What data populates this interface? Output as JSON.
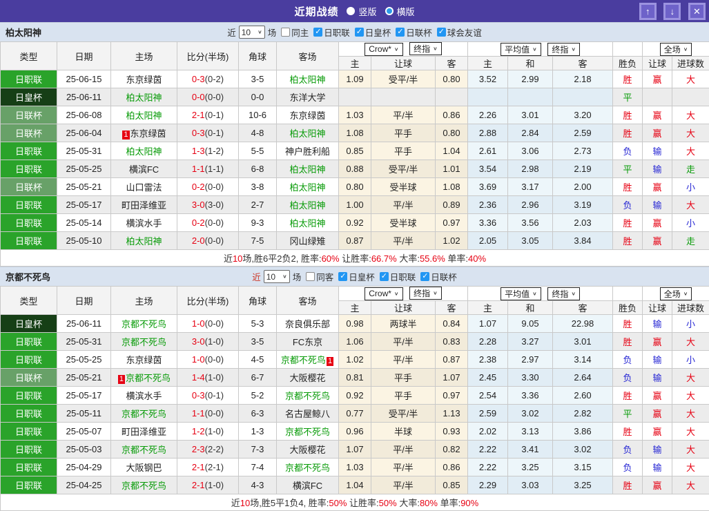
{
  "titlebar": {
    "title": "近期战绩",
    "radio_vertical": "竖版",
    "radio_horizontal": "横版",
    "up_button": "↑",
    "down_button": "↓",
    "close_button": "✕"
  },
  "colors": {
    "header_purple": "#4a3d9f",
    "section_bg": "#d9e3f0",
    "league_green": "#2aa32a",
    "emperor_cup_green": "#163f16",
    "levain_cup_green": "#68a168",
    "win_red": "#e60012",
    "lose_blue": "#2727d4",
    "draw_green": "#089b08",
    "checkbox_blue": "#2196f3"
  },
  "columns": [
    "类型",
    "日期",
    "主场",
    "比分(半场)",
    "角球",
    "客场"
  ],
  "odds_columns": [
    "主",
    "让球",
    "客",
    "主",
    "和",
    "客",
    "胜负",
    "让球",
    "进球数"
  ],
  "odds_header": {
    "bookmaker": "Crow*",
    "final": "终指",
    "average": "平均值",
    "fulltime": "全场"
  },
  "sections": [
    {
      "team": "柏太阳神",
      "filter": {
        "near": "近",
        "count": "10",
        "games": "场",
        "checkboxes": [
          {
            "label": "同主",
            "checked": false
          },
          {
            "label": "日职联",
            "checked": true
          },
          {
            "label": "日皇杯",
            "checked": true
          },
          {
            "label": "日联杯",
            "checked": true
          },
          {
            "label": "球会友谊",
            "checked": true
          }
        ]
      },
      "rows": [
        {
          "type": "日职联",
          "date": "25-06-15",
          "home": "东京绿茵",
          "score": "0-3",
          "half": "(0-2)",
          "corner": "3-5",
          "away": "柏太阳神",
          "away_focal": true,
          "odds": [
            "1.09",
            "受平/半",
            "0.80",
            "3.52",
            "2.99",
            "2.18"
          ],
          "results": [
            "胜",
            "赢",
            "大"
          ]
        },
        {
          "type": "日皇杯",
          "date": "25-06-11",
          "home": "柏太阳神",
          "home_focal": true,
          "score": "0-0",
          "half": "(0-0)",
          "corner": "0-0",
          "away": "东洋大学",
          "odds": [
            "",
            "",
            "",
            "",
            "",
            ""
          ],
          "results": [
            "平",
            "",
            ""
          ]
        },
        {
          "type": "日联杯",
          "date": "25-06-08",
          "home": "柏太阳神",
          "home_focal": true,
          "score": "2-1",
          "half": "(0-1)",
          "corner": "10-6",
          "away": "东京绿茵",
          "odds": [
            "1.03",
            "平/半",
            "0.86",
            "2.26",
            "3.01",
            "3.20"
          ],
          "results": [
            "胜",
            "赢",
            "大"
          ]
        },
        {
          "type": "日联杯",
          "date": "25-06-04",
          "home": "东京绿茵",
          "home_card": "1",
          "score": "0-3",
          "half": "(0-1)",
          "corner": "4-8",
          "away": "柏太阳神",
          "away_focal": true,
          "odds": [
            "1.08",
            "平手",
            "0.80",
            "2.88",
            "2.84",
            "2.59"
          ],
          "results": [
            "胜",
            "赢",
            "大"
          ]
        },
        {
          "type": "日职联",
          "date": "25-05-31",
          "home": "柏太阳神",
          "home_focal": true,
          "score": "1-3",
          "half": "(1-2)",
          "corner": "5-5",
          "away": "神户胜利船",
          "odds": [
            "0.85",
            "平手",
            "1.04",
            "2.61",
            "3.06",
            "2.73"
          ],
          "results": [
            "负",
            "输",
            "大"
          ]
        },
        {
          "type": "日职联",
          "date": "25-05-25",
          "home": "横滨FC",
          "score": "1-1",
          "half": "(1-1)",
          "corner": "6-8",
          "away": "柏太阳神",
          "away_focal": true,
          "odds": [
            "0.88",
            "受平/半",
            "1.01",
            "3.54",
            "2.98",
            "2.19"
          ],
          "results": [
            "平",
            "输",
            "走"
          ]
        },
        {
          "type": "日联杯",
          "date": "25-05-21",
          "home": "山口雷法",
          "score": "0-2",
          "half": "(0-0)",
          "corner": "3-8",
          "away": "柏太阳神",
          "away_focal": true,
          "odds": [
            "0.80",
            "受半球",
            "1.08",
            "3.69",
            "3.17",
            "2.00"
          ],
          "results": [
            "胜",
            "赢",
            "小"
          ]
        },
        {
          "type": "日职联",
          "date": "25-05-17",
          "home": "町田泽维亚",
          "score": "3-0",
          "half": "(3-0)",
          "corner": "2-7",
          "away": "柏太阳神",
          "away_focal": true,
          "odds": [
            "1.00",
            "平/半",
            "0.89",
            "2.36",
            "2.96",
            "3.19"
          ],
          "results": [
            "负",
            "输",
            "大"
          ]
        },
        {
          "type": "日职联",
          "date": "25-05-14",
          "home": "横滨水手",
          "score": "0-2",
          "half": "(0-0)",
          "corner": "9-3",
          "away": "柏太阳神",
          "away_focal": true,
          "odds": [
            "0.92",
            "受半球",
            "0.97",
            "3.36",
            "3.56",
            "2.03"
          ],
          "results": [
            "胜",
            "赢",
            "小"
          ]
        },
        {
          "type": "日职联",
          "date": "25-05-10",
          "home": "柏太阳神",
          "home_focal": true,
          "score": "2-0",
          "half": "(0-0)",
          "corner": "7-5",
          "away": "冈山绿雉",
          "odds": [
            "0.87",
            "平/半",
            "1.02",
            "2.05",
            "3.05",
            "3.84"
          ],
          "results": [
            "胜",
            "赢",
            "走"
          ]
        }
      ],
      "summary": [
        {
          "t": "近",
          "red": false
        },
        {
          "t": "10",
          "red": true
        },
        {
          "t": "场,胜6平2负2, 胜率:",
          "red": false
        },
        {
          "t": "60%",
          "red": true
        },
        {
          "t": " 让胜率:",
          "red": false
        },
        {
          "t": "66.7%",
          "red": true
        },
        {
          "t": " 大率:",
          "red": false
        },
        {
          "t": "55.6%",
          "red": true
        },
        {
          "t": " 单率:",
          "red": false
        },
        {
          "t": "40%",
          "red": true
        }
      ]
    },
    {
      "team": "京都不死鸟",
      "filter": {
        "near": "近",
        "count": "10",
        "games": "场",
        "checkboxes": [
          {
            "label": "同客",
            "checked": false
          },
          {
            "label": "日皇杯",
            "checked": true
          },
          {
            "label": "日职联",
            "checked": true
          },
          {
            "label": "日联杯",
            "checked": true
          }
        ]
      },
      "rows": [
        {
          "type": "日皇杯",
          "date": "25-06-11",
          "home": "京都不死鸟",
          "home_focal": true,
          "score": "1-0",
          "half": "(0-0)",
          "corner": "5-3",
          "away": "奈良俱乐部",
          "odds": [
            "0.98",
            "两球半",
            "0.84",
            "1.07",
            "9.05",
            "22.98"
          ],
          "results": [
            "胜",
            "输",
            "小"
          ]
        },
        {
          "type": "日职联",
          "date": "25-05-31",
          "home": "京都不死鸟",
          "home_focal": true,
          "score": "3-0",
          "half": "(1-0)",
          "corner": "3-5",
          "away": "FC东京",
          "odds": [
            "1.06",
            "平/半",
            "0.83",
            "2.28",
            "3.27",
            "3.01"
          ],
          "results": [
            "胜",
            "赢",
            "大"
          ]
        },
        {
          "type": "日职联",
          "date": "25-05-25",
          "home": "东京绿茵",
          "score": "1-0",
          "half": "(0-0)",
          "corner": "4-5",
          "away": "京都不死鸟",
          "away_focal": true,
          "away_card": "1",
          "odds": [
            "1.02",
            "平/半",
            "0.87",
            "2.38",
            "2.97",
            "3.14"
          ],
          "results": [
            "负",
            "输",
            "小"
          ]
        },
        {
          "type": "日联杯",
          "date": "25-05-21",
          "home": "京都不死鸟",
          "home_focal": true,
          "home_card": "1",
          "score": "1-4",
          "half": "(1-0)",
          "corner": "6-7",
          "away": "大阪樱花",
          "odds": [
            "0.81",
            "平手",
            "1.07",
            "2.45",
            "3.30",
            "2.64"
          ],
          "results": [
            "负",
            "输",
            "大"
          ]
        },
        {
          "type": "日职联",
          "date": "25-05-17",
          "home": "横滨水手",
          "score": "0-3",
          "half": "(0-1)",
          "corner": "5-2",
          "away": "京都不死鸟",
          "away_focal": true,
          "odds": [
            "0.92",
            "平手",
            "0.97",
            "2.54",
            "3.36",
            "2.60"
          ],
          "results": [
            "胜",
            "赢",
            "大"
          ]
        },
        {
          "type": "日职联",
          "date": "25-05-11",
          "home": "京都不死鸟",
          "home_focal": true,
          "score": "1-1",
          "half": "(0-0)",
          "corner": "6-3",
          "away": "名古屋鲸八",
          "odds": [
            "0.77",
            "受平/半",
            "1.13",
            "2.59",
            "3.02",
            "2.82"
          ],
          "results": [
            "平",
            "赢",
            "大"
          ]
        },
        {
          "type": "日职联",
          "date": "25-05-07",
          "home": "町田泽维亚",
          "score": "1-2",
          "half": "(1-0)",
          "corner": "1-3",
          "away": "京都不死鸟",
          "away_focal": true,
          "odds": [
            "0.96",
            "半球",
            "0.93",
            "2.02",
            "3.13",
            "3.86"
          ],
          "results": [
            "胜",
            "赢",
            "大"
          ]
        },
        {
          "type": "日职联",
          "date": "25-05-03",
          "home": "京都不死鸟",
          "home_focal": true,
          "score": "2-3",
          "half": "(2-2)",
          "corner": "7-3",
          "away": "大阪樱花",
          "odds": [
            "1.07",
            "平/半",
            "0.82",
            "2.22",
            "3.41",
            "3.02"
          ],
          "results": [
            "负",
            "输",
            "大"
          ]
        },
        {
          "type": "日职联",
          "date": "25-04-29",
          "home": "大阪钢巴",
          "score": "2-1",
          "half": "(2-1)",
          "corner": "7-4",
          "away": "京都不死鸟",
          "away_focal": true,
          "odds": [
            "1.03",
            "平/半",
            "0.86",
            "2.22",
            "3.25",
            "3.15"
          ],
          "results": [
            "负",
            "输",
            "大"
          ]
        },
        {
          "type": "日职联",
          "date": "25-04-25",
          "home": "京都不死鸟",
          "home_focal": true,
          "score": "2-1",
          "half": "(1-0)",
          "corner": "4-3",
          "away": "横滨FC",
          "odds": [
            "1.04",
            "平/半",
            "0.85",
            "2.29",
            "3.03",
            "3.25"
          ],
          "results": [
            "胜",
            "赢",
            "大"
          ]
        }
      ],
      "summary": [
        {
          "t": "近",
          "red": false
        },
        {
          "t": "10",
          "red": true
        },
        {
          "t": "场,胜5平1负4, 胜率:",
          "red": false
        },
        {
          "t": "50%",
          "red": true
        },
        {
          "t": " 让胜率:",
          "red": false
        },
        {
          "t": "50%",
          "red": true
        },
        {
          "t": " 大率:",
          "red": false
        },
        {
          "t": "80%",
          "red": true
        },
        {
          "t": " 单率:",
          "red": false
        },
        {
          "t": "90%",
          "red": true
        }
      ]
    }
  ]
}
